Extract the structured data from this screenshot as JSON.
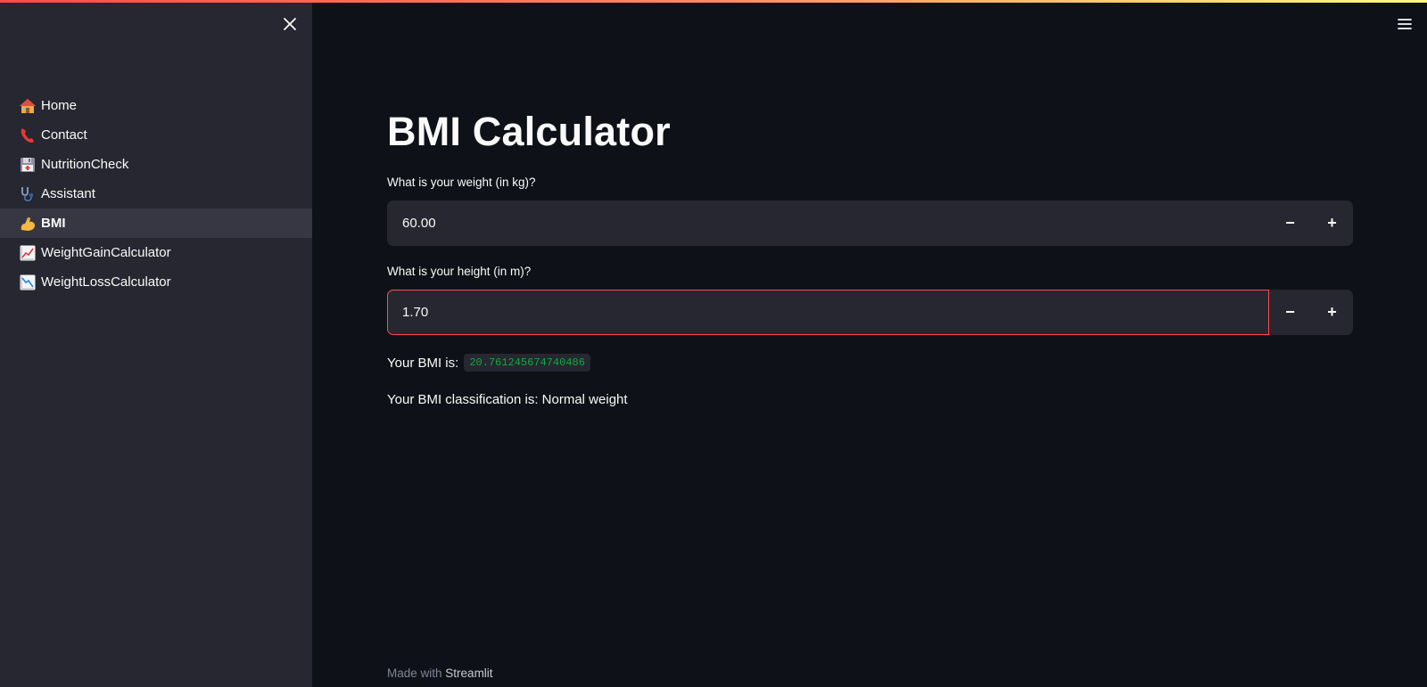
{
  "sidebar": {
    "items": [
      {
        "label": "Home",
        "icon": "house-icon",
        "active": false
      },
      {
        "label": "Contact",
        "icon": "telephone-icon",
        "active": false
      },
      {
        "label": "NutritionCheck",
        "icon": "floppy-disk-icon",
        "active": false
      },
      {
        "label": "Assistant",
        "icon": "stethoscope-icon",
        "active": false
      },
      {
        "label": "BMI",
        "icon": "flexed-biceps-icon",
        "active": true
      },
      {
        "label": "WeightGainCalculator",
        "icon": "chart-increasing-icon",
        "active": false
      },
      {
        "label": "WeightLossCalculator",
        "icon": "chart-decreasing-icon",
        "active": false
      }
    ]
  },
  "main": {
    "title": "BMI Calculator",
    "weight": {
      "label": "What is your weight (in kg)?",
      "value": "60.00",
      "minus": "−",
      "plus": "+"
    },
    "height": {
      "label": "What is your height (in m)?",
      "value": "1.70",
      "minus": "−",
      "plus": "+"
    },
    "bmi_result": {
      "label": "Your BMI is:",
      "value": "20.761245674740486"
    },
    "classification": "Your BMI classification is: Normal weight"
  },
  "footer": {
    "prefix": "Made with",
    "brand": "Streamlit"
  },
  "colors": {
    "background": "#0e1117",
    "sidebar": "#262730",
    "accent": "#ff4b4b",
    "code_green": "#09ab3b"
  }
}
